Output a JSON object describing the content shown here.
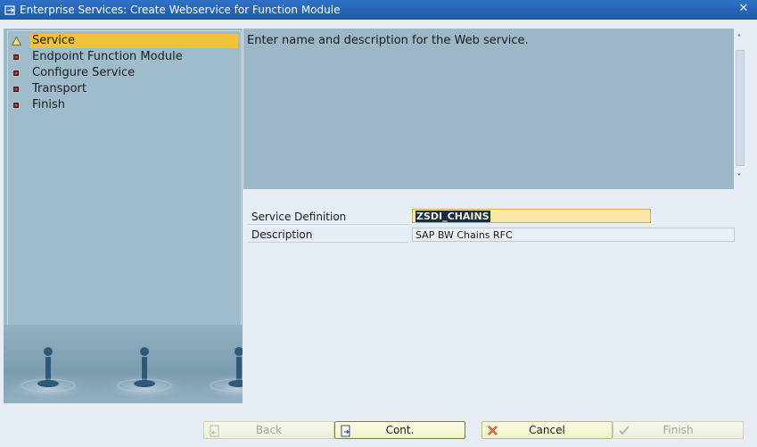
{
  "window": {
    "title": "Enterprise Services: Create Webservice for Function Module",
    "close_symbol": "✕"
  },
  "roadmap": {
    "steps": [
      {
        "label": "Service",
        "active": true,
        "icon": "warning-triangle-icon"
      },
      {
        "label": "Endpoint Function Module",
        "active": false,
        "icon": "step-bullet-icon"
      },
      {
        "label": "Configure Service",
        "active": false,
        "icon": "step-bullet-icon"
      },
      {
        "label": "Transport",
        "active": false,
        "icon": "step-bullet-icon"
      },
      {
        "label": "Finish",
        "active": false,
        "icon": "step-bullet-icon"
      }
    ]
  },
  "info": {
    "text": "Enter name and description for the Web service."
  },
  "form": {
    "service_definition": {
      "label": "Service Definition",
      "value": "ZSDI_CHAINS"
    },
    "description": {
      "label": "Description",
      "value": "SAP BW Chains RFC"
    }
  },
  "buttons": {
    "back": "Back",
    "cont": "Cont.",
    "cancel": "Cancel",
    "finish": "Finish"
  },
  "colors": {
    "title_bar": "#1d5ab0",
    "panel": "#9cb8c8",
    "active_step": "#f2c23a",
    "button": "#f1f3c4"
  }
}
